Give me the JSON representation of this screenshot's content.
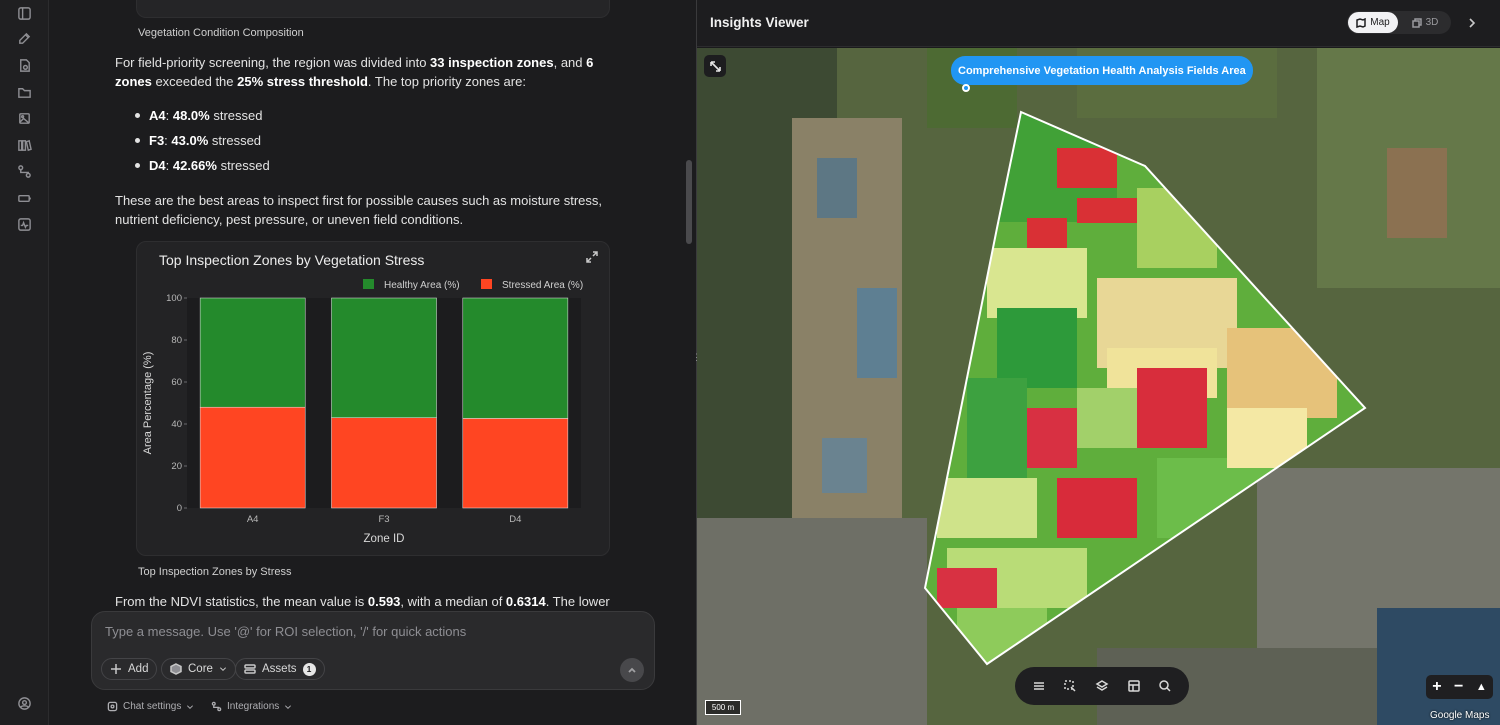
{
  "chat": {
    "top_caption": "Vegetation Condition Composition",
    "para1": {
      "t1": "For field-priority screening, the region was divided into ",
      "b1": "33 inspection zones",
      "t2": ", and ",
      "b2": "6 zones",
      "t3": " exceeded the ",
      "b3": "25% stress threshold",
      "t4": ". The top priority zones are:"
    },
    "bullets": [
      {
        "zone": "A4",
        "value": "48.0%",
        "suffix": " stressed"
      },
      {
        "zone": "F3",
        "value": "43.0%",
        "suffix": " stressed"
      },
      {
        "zone": "D4",
        "value": "42.66%",
        "suffix": " stressed"
      }
    ],
    "para2": "These are the best areas to inspect first for possible causes such as moisture stress, nutrient deficiency, pest pressure, or uneven field conditions.",
    "chart_caption": "Top Inspection Zones by Stress",
    "para3": {
      "t1": "From the NDVI statistics, the mean value is ",
      "b1": "0.593",
      "t2": ", with a median of ",
      "b2": "0.6314",
      "t3": ". The lower tail"
    }
  },
  "chart_data": {
    "type": "bar",
    "stacked": true,
    "title": "Top Inspection Zones by Vegetation Stress",
    "xlabel": "Zone ID",
    "ylabel": "Area Percentage (%)",
    "categories": [
      "A4",
      "F3",
      "D4"
    ],
    "ylim": [
      0,
      100
    ],
    "yticks": [
      0,
      20,
      40,
      60,
      80,
      100
    ],
    "legend_position": "top-right",
    "series": [
      {
        "name": "Stressed Area (%)",
        "values": [
          48.0,
          43.0,
          42.66
        ],
        "color": "#ff4522"
      },
      {
        "name": "Healthy Area (%)",
        "values": [
          52.0,
          57.0,
          57.34
        ],
        "color": "#248a2c"
      }
    ],
    "legend_order": [
      "Healthy Area (%)",
      "Stressed Area (%)"
    ]
  },
  "composer": {
    "placeholder": "Type a message. Use '@' for ROI selection, '/' for quick actions",
    "add_label": "Add",
    "core_label": "Core",
    "assets_label": "Assets",
    "assets_count": "1"
  },
  "footer": {
    "chat_settings": "Chat settings",
    "integrations": "Integrations"
  },
  "viewer": {
    "title": "Insights Viewer",
    "map_label": "Map",
    "threed_label": "3D",
    "roi_label": "Comprehensive Vegetation Health Analysis Fields Area",
    "scale": "500 m",
    "attribution": "Google Maps",
    "zoom_in": "+",
    "zoom_out": "−"
  },
  "colors": {
    "accent": "#2196f3",
    "healthy": "#248a2c",
    "stressed": "#ff4522"
  }
}
